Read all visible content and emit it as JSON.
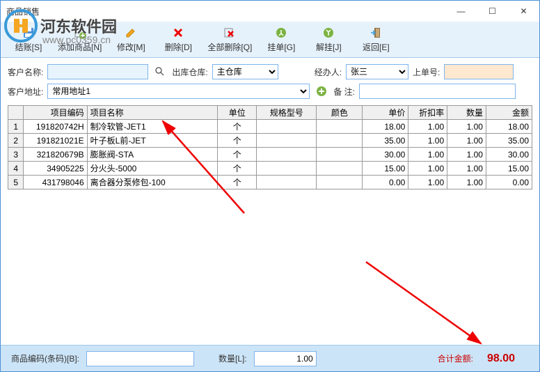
{
  "window": {
    "title": "商品销售"
  },
  "watermark": {
    "text": "河东软件园",
    "url": "www.pc0359.cn"
  },
  "toolbar": [
    {
      "name": "btn-settle",
      "label": "结账[S]",
      "icon": "save"
    },
    {
      "name": "btn-add",
      "label": "添加商品[N]",
      "icon": "add"
    },
    {
      "name": "btn-modify",
      "label": "修改[M]",
      "icon": "edit"
    },
    {
      "name": "btn-delete",
      "label": "删除[D]",
      "icon": "del"
    },
    {
      "name": "btn-delall",
      "label": "全部删除[Q]",
      "icon": "delall"
    },
    {
      "name": "btn-hold",
      "label": "挂单[G]",
      "icon": "hold"
    },
    {
      "name": "btn-unhold",
      "label": "解挂[J]",
      "icon": "unhold"
    },
    {
      "name": "btn-return",
      "label": "返回[E]",
      "icon": "exit"
    }
  ],
  "form": {
    "customer_name_label": "客户名称:",
    "customer_name": "",
    "warehouse_label": "出库仓库:",
    "warehouse": "主仓库",
    "handler_label": "经办人:",
    "handler": "张三",
    "order_no_label": "上单号:",
    "order_no": "",
    "customer_addr_label": "客户地址:",
    "customer_addr": "常用地址1",
    "remark_label": "备  注:",
    "remark": ""
  },
  "table": {
    "headers": {
      "row": "",
      "code": "项目编码",
      "name": "项目名称",
      "unit": "单位",
      "spec": "规格型号",
      "color": "颜色",
      "price": "单价",
      "discount": "折扣率",
      "qty": "数量",
      "amount": "金额"
    },
    "rows": [
      {
        "num": "1",
        "code": "191820742H",
        "name": "制冷软管-JET1",
        "unit": "个",
        "spec": "",
        "color": "",
        "price": "18.00",
        "discount": "1.00",
        "qty": "1.00",
        "amount": "18.00"
      },
      {
        "num": "2",
        "code": "191821021E",
        "name": "叶子板L前-JET",
        "unit": "个",
        "spec": "",
        "color": "",
        "price": "35.00",
        "discount": "1.00",
        "qty": "1.00",
        "amount": "35.00"
      },
      {
        "num": "3",
        "code": "321820679B",
        "name": "膨胀阀-STA",
        "unit": "个",
        "spec": "",
        "color": "",
        "price": "30.00",
        "discount": "1.00",
        "qty": "1.00",
        "amount": "30.00"
      },
      {
        "num": "4",
        "code": "34905225",
        "name": "分火头-5000",
        "unit": "个",
        "spec": "",
        "color": "",
        "price": "15.00",
        "discount": "1.00",
        "qty": "1.00",
        "amount": "15.00"
      },
      {
        "num": "5",
        "code": "431798046",
        "name": "离合器分泵修包-100",
        "unit": "个",
        "spec": "",
        "color": "",
        "price": "0.00",
        "discount": "1.00",
        "qty": "1.00",
        "amount": "0.00"
      }
    ]
  },
  "bottom": {
    "code_label": "商品编码(条码)[B]:",
    "code": "",
    "qty_label": "数量[L]:",
    "qty": "1.00",
    "total_label": "合计金额:",
    "total": "98.00"
  }
}
